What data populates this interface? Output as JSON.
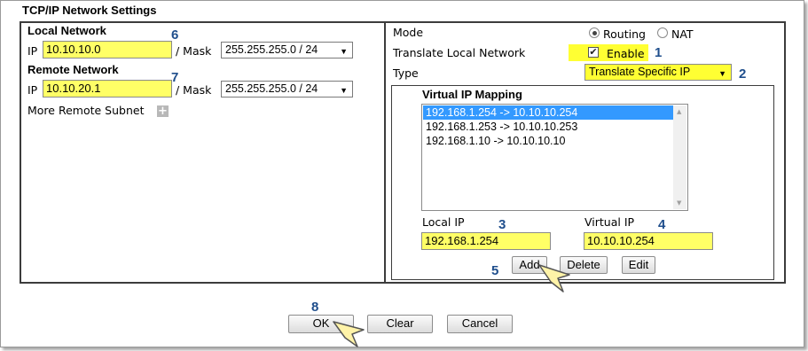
{
  "title": "TCP/IP Network Settings",
  "local_network": {
    "heading": "Local Network",
    "ip_label": "IP",
    "ip_value": "10.10.10.0",
    "mask_label": "/ Mask",
    "mask_value": "255.255.255.0 / 24"
  },
  "remote_network": {
    "heading": "Remote Network",
    "ip_label": "IP",
    "ip_value": "10.10.20.1",
    "mask_label": "/ Mask",
    "mask_value": "255.255.255.0 / 24",
    "more_subnet_label": "More Remote Subnet"
  },
  "mode": {
    "label": "Mode",
    "options": [
      "Routing",
      "NAT"
    ],
    "selected": "Routing"
  },
  "translate": {
    "label": "Translate Local Network",
    "checkbox_label": "Enable",
    "checked": true
  },
  "type": {
    "label": "Type",
    "value": "Translate Specific IP"
  },
  "mapping": {
    "heading": "Virtual IP Mapping",
    "items": [
      "192.168.1.254 -> 10.10.10.254",
      "192.168.1.253 -> 10.10.10.253",
      "192.168.1.10 -> 10.10.10.10"
    ],
    "selected_index": 0,
    "local_ip_label": "Local IP",
    "local_ip_value": "192.168.1.254",
    "virtual_ip_label": "Virtual IP",
    "virtual_ip_value": "10.10.10.254",
    "add_label": "Add",
    "delete_label": "Delete",
    "edit_label": "Edit"
  },
  "footer": {
    "ok_label": "OK",
    "clear_label": "Clear",
    "cancel_label": "Cancel"
  },
  "callouts": [
    "1",
    "2",
    "3",
    "4",
    "5",
    "6",
    "7",
    "8"
  ],
  "colors": {
    "highlight": "#ffff33",
    "input_highlight": "#ffff66",
    "callout": "#1f4e8c",
    "selection": "#3399ff"
  }
}
